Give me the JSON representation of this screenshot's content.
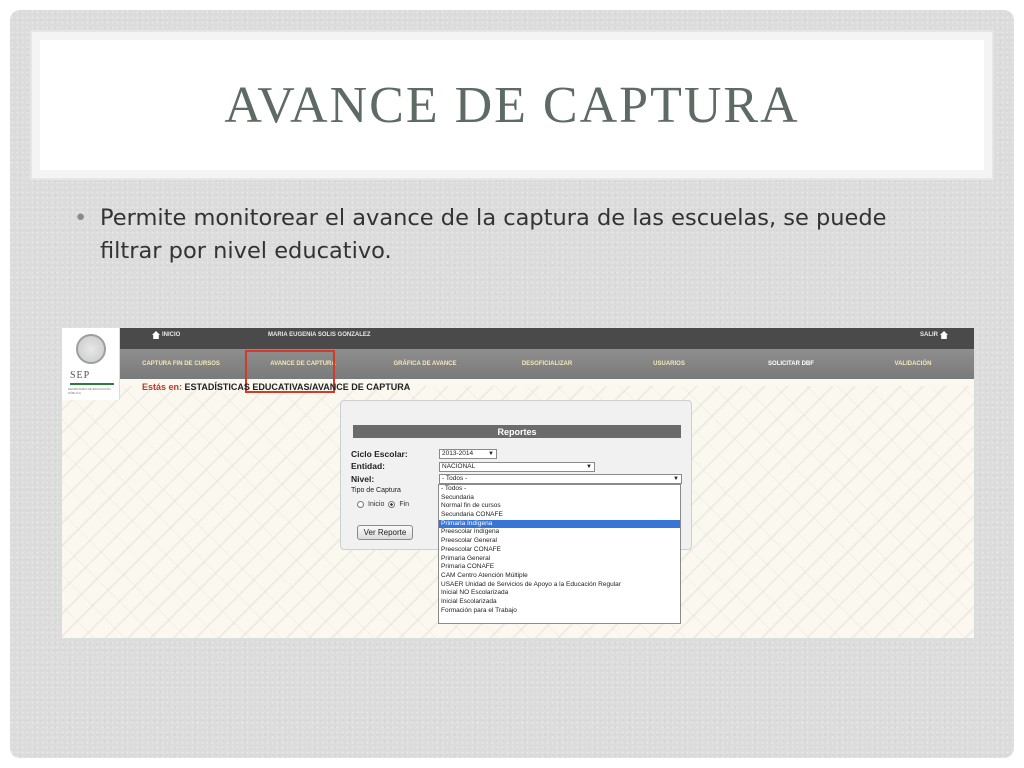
{
  "slide": {
    "title": "AVANCE DE CAPTURA",
    "bullet": "Permite monitorear el avance de la captura de las escuelas, se puede filtrar por nivel educativo."
  },
  "app": {
    "logo": {
      "text": "SEP",
      "subtext": "SECRETARÍA DE EDUCACIÓN PÚBLICA"
    },
    "topbar": {
      "home_label": "INICIO",
      "user_name": "MARIA EUGENIA SOLIS GONZALEZ",
      "logout_label": "SALIR"
    },
    "nav": [
      {
        "label": "CAPTURA FIN DE CURSOS"
      },
      {
        "label": "AVANCE DE CAPTURA"
      },
      {
        "label": "GRÁFICA DE AVANCE"
      },
      {
        "label": "DESOFICIALIZAR"
      },
      {
        "label": "USUARIOS"
      },
      {
        "label": "SOLICITAR DBF"
      },
      {
        "label": "VALIDACIÓN"
      }
    ],
    "breadcrumb": {
      "prefix": "Estás en:",
      "path": "ESTADÍSTICAS EDUCATIVAS/AVANCE DE CAPTURA"
    },
    "report": {
      "header": "Reportes",
      "ciclo_label": "Ciclo Escolar:",
      "ciclo_value": "2013-2014",
      "entidad_label": "Entidad:",
      "entidad_value": "NACIONAL",
      "nivel_label": "Nivel:",
      "nivel_value": "- Todos -",
      "tipo_label": "Tipo de Captura",
      "radio_inicio": "Inicio",
      "radio_fin": "Fin",
      "button_label": "Ver Reporte"
    },
    "nivel_options": [
      "- Todos -",
      "Secundaria",
      "Normal fin de cursos",
      "Secundaria CONAFE",
      "Primaria Indígena",
      "Preescolar Indígena",
      "Preescolar General",
      "Preescolar CONAFE",
      "Primaria General",
      "Primaria CONAFE",
      "CAM Centro Atención Múltiple",
      "USAER Unidad de Servicios de Apoyo a la Educación Regular",
      "Inicial NO Escolarizada",
      "Inicial Escolarizada",
      "Formación para el Trabajo"
    ],
    "nivel_selected_index": 4,
    "colors": {
      "highlight": "#d43a2a",
      "selected_option": "#3875d7",
      "breadcrumb_prefix": "#c0392b"
    }
  }
}
